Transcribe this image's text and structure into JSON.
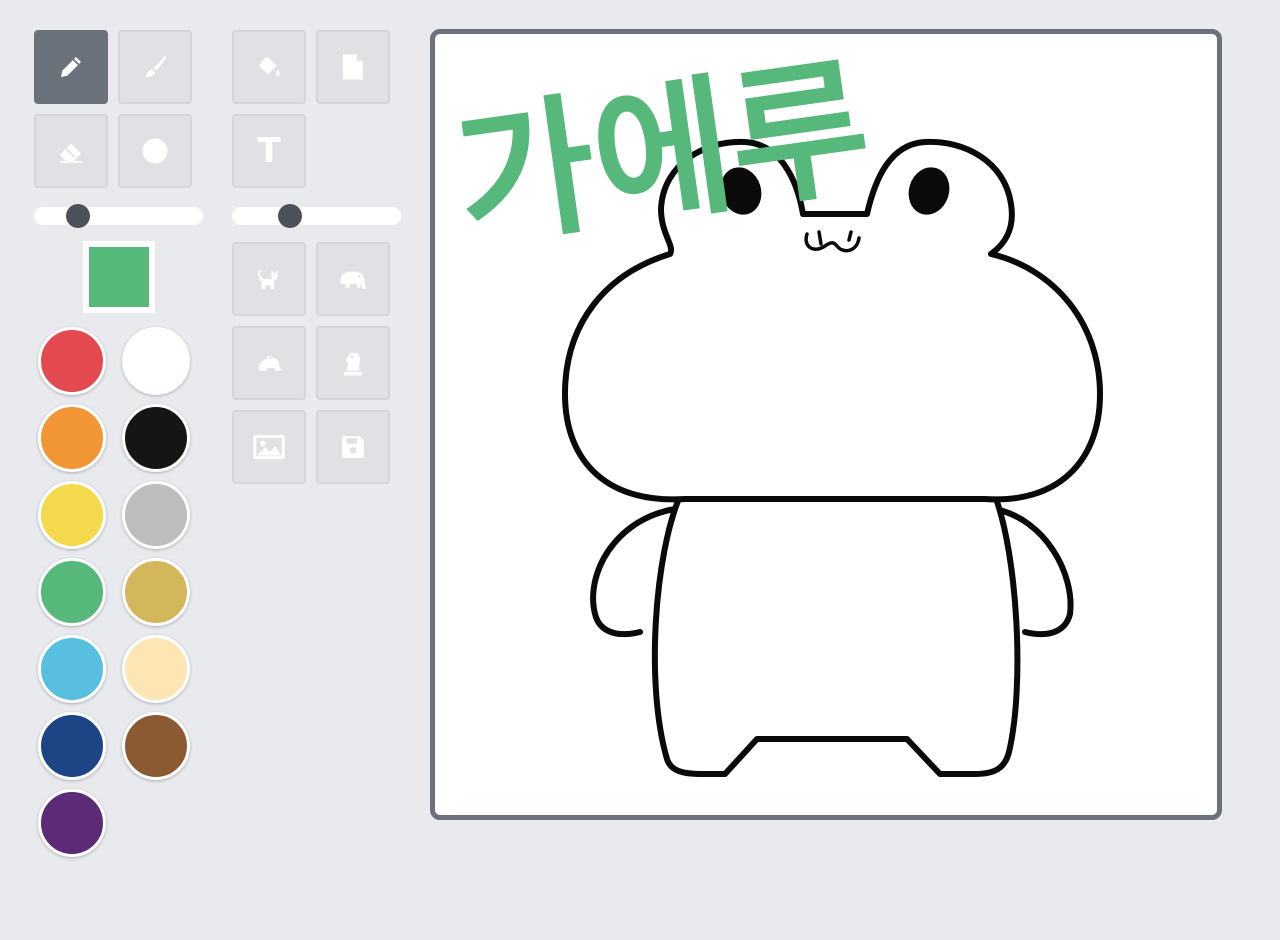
{
  "tools": {
    "pencil": {
      "icon": "pencil-icon",
      "active": true
    },
    "brush": {
      "icon": "brush-icon"
    },
    "fill": {
      "icon": "paint-bucket-icon"
    },
    "new_page": {
      "icon": "new-page-icon"
    },
    "eraser": {
      "icon": "eraser-icon"
    },
    "dot": {
      "icon": "circle-icon"
    },
    "text": {
      "icon": "text-icon",
      "glyph": "T"
    }
  },
  "sliders": {
    "brush_size": 0.22,
    "opacity": 0.32
  },
  "current_color": "#56b87b",
  "palette": [
    "#e34a4f",
    "#ffffff",
    "#f29535",
    "#151515",
    "#f5d94c",
    "#bdbdbd",
    "#56b87b",
    "#d4b75a",
    "#59bfe0",
    "#fde6b4",
    "#1d4485",
    "#8b5a32",
    "#5c2a76"
  ],
  "stamps": [
    {
      "icon": "cat-icon"
    },
    {
      "icon": "elephant-icon"
    },
    {
      "icon": "frog-icon"
    },
    {
      "icon": "chess-knight-icon"
    },
    {
      "icon": "image-icon"
    },
    {
      "icon": "save-icon"
    }
  ],
  "canvas": {
    "text": "가에루",
    "text_color": "#56b87b"
  }
}
